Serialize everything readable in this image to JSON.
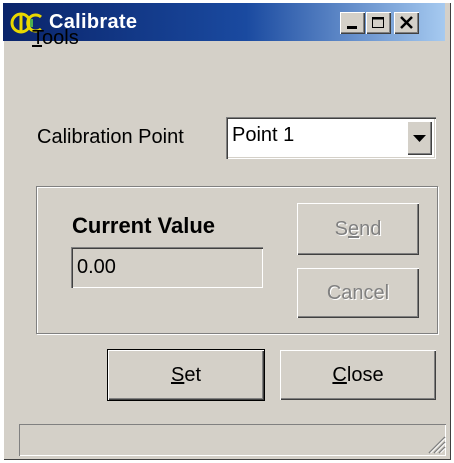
{
  "window": {
    "title": "Calibrate",
    "logo_text": "AIC",
    "controls": [
      "minimize-icon",
      "maximize-icon",
      "close-icon"
    ]
  },
  "menu": {
    "items": [
      {
        "label": "Tools",
        "mnemonic": "T",
        "rest": "ools"
      }
    ]
  },
  "calibration_point": {
    "label": "Calibration Point",
    "selected": "Point 1"
  },
  "current_value": {
    "label": "Current Value",
    "value": "0.00"
  },
  "buttons": {
    "send": {
      "pre": "S",
      "u": "e",
      "post": "nd",
      "enabled": false
    },
    "cancel": {
      "label": "Cancel",
      "enabled": false
    },
    "set": {
      "u": "S",
      "post": "et"
    },
    "close": {
      "u": "C",
      "post": "lose"
    }
  },
  "colors": {
    "title_gradient_start": "#0a246a",
    "title_gradient_end": "#a6caf0",
    "face": "#d4d0c8"
  }
}
